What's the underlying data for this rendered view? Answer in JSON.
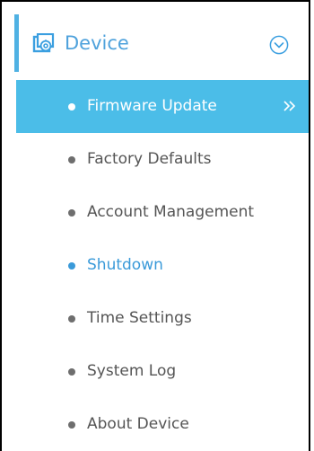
{
  "section": {
    "title": "Device",
    "icon": "device-settings-icon",
    "toggle_icon": "chevron-down-circle-icon"
  },
  "menu": {
    "items": [
      {
        "label": "Firmware Update",
        "state": "active"
      },
      {
        "label": "Factory Defaults",
        "state": "normal"
      },
      {
        "label": "Account Management",
        "state": "normal"
      },
      {
        "label": "Shutdown",
        "state": "hover"
      },
      {
        "label": "Time Settings",
        "state": "normal"
      },
      {
        "label": "System Log",
        "state": "normal"
      },
      {
        "label": "About Device",
        "state": "normal"
      }
    ],
    "active_icon": "double-chevron-right-icon"
  },
  "colors": {
    "accent": "#4fb1e3",
    "active_background": "#4bbde8",
    "hover_text": "#3a9ad9",
    "text": "#555555"
  }
}
